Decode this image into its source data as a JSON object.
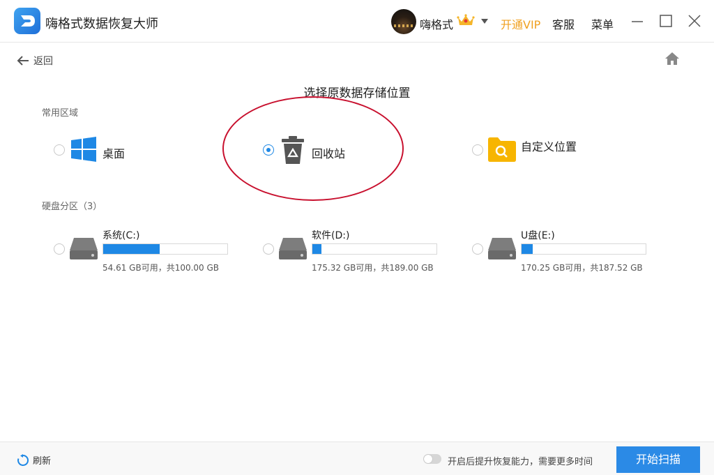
{
  "window": {
    "title": "嗨格式数据恢复大师",
    "username": "嗨格式",
    "vip_label": "开通VIP",
    "service_label": "客服",
    "menu_label": "菜单"
  },
  "nav": {
    "back_label": "返回"
  },
  "page": {
    "title": "选择原数据存储位置"
  },
  "common_area": {
    "label": "常用区域",
    "items": [
      {
        "label": "桌面",
        "icon": "windows-icon",
        "selected": false
      },
      {
        "label": "回收站",
        "icon": "recycle-bin-icon",
        "selected": true
      },
      {
        "label": "自定义位置",
        "icon": "folder-search-icon",
        "selected": false
      }
    ]
  },
  "partitions": {
    "label": "硬盘分区（3）",
    "drives": [
      {
        "name": "系统(C:)",
        "info": "54.61 GB可用，共100.00 GB",
        "used_fraction": 0.454,
        "icon": "hard-drive-icon"
      },
      {
        "name": "软件(D:)",
        "info": "175.32 GB可用，共189.00 GB",
        "used_fraction": 0.072,
        "icon": "hard-drive-icon"
      },
      {
        "name": "U盘(E:)",
        "info": "170.25 GB可用，共187.52 GB",
        "used_fraction": 0.092,
        "icon": "hard-drive-icon"
      }
    ]
  },
  "footer": {
    "refresh_label": "刷新",
    "toggle_label": "开启后提升恢复能力，需要更多时间",
    "toggle_on": false,
    "start_label": "开始扫描"
  },
  "colors": {
    "accent": "#1e88e5",
    "vip": "#f0a020",
    "annotation": "#c8102e"
  }
}
